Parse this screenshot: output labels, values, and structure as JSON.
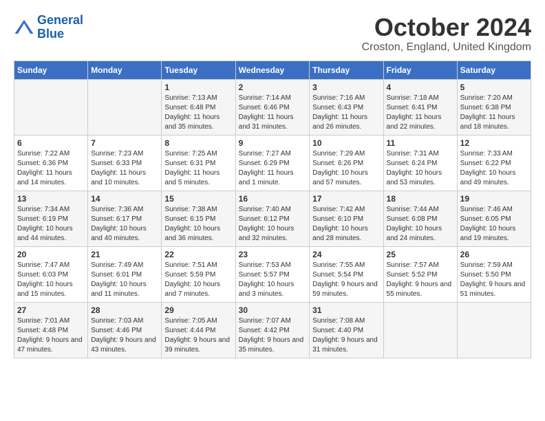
{
  "logo": {
    "line1": "General",
    "line2": "Blue"
  },
  "header": {
    "month": "October 2024",
    "location": "Croston, England, United Kingdom"
  },
  "weekdays": [
    "Sunday",
    "Monday",
    "Tuesday",
    "Wednesday",
    "Thursday",
    "Friday",
    "Saturday"
  ],
  "weeks": [
    [
      {
        "day": "",
        "sunrise": "",
        "sunset": "",
        "daylight": ""
      },
      {
        "day": "",
        "sunrise": "",
        "sunset": "",
        "daylight": ""
      },
      {
        "day": "1",
        "sunrise": "Sunrise: 7:13 AM",
        "sunset": "Sunset: 6:48 PM",
        "daylight": "Daylight: 11 hours and 35 minutes."
      },
      {
        "day": "2",
        "sunrise": "Sunrise: 7:14 AM",
        "sunset": "Sunset: 6:46 PM",
        "daylight": "Daylight: 11 hours and 31 minutes."
      },
      {
        "day": "3",
        "sunrise": "Sunrise: 7:16 AM",
        "sunset": "Sunset: 6:43 PM",
        "daylight": "Daylight: 11 hours and 26 minutes."
      },
      {
        "day": "4",
        "sunrise": "Sunrise: 7:18 AM",
        "sunset": "Sunset: 6:41 PM",
        "daylight": "Daylight: 11 hours and 22 minutes."
      },
      {
        "day": "5",
        "sunrise": "Sunrise: 7:20 AM",
        "sunset": "Sunset: 6:38 PM",
        "daylight": "Daylight: 11 hours and 18 minutes."
      }
    ],
    [
      {
        "day": "6",
        "sunrise": "Sunrise: 7:22 AM",
        "sunset": "Sunset: 6:36 PM",
        "daylight": "Daylight: 11 hours and 14 minutes."
      },
      {
        "day": "7",
        "sunrise": "Sunrise: 7:23 AM",
        "sunset": "Sunset: 6:33 PM",
        "daylight": "Daylight: 11 hours and 10 minutes."
      },
      {
        "day": "8",
        "sunrise": "Sunrise: 7:25 AM",
        "sunset": "Sunset: 6:31 PM",
        "daylight": "Daylight: 11 hours and 5 minutes."
      },
      {
        "day": "9",
        "sunrise": "Sunrise: 7:27 AM",
        "sunset": "Sunset: 6:29 PM",
        "daylight": "Daylight: 11 hours and 1 minute."
      },
      {
        "day": "10",
        "sunrise": "Sunrise: 7:29 AM",
        "sunset": "Sunset: 6:26 PM",
        "daylight": "Daylight: 10 hours and 57 minutes."
      },
      {
        "day": "11",
        "sunrise": "Sunrise: 7:31 AM",
        "sunset": "Sunset: 6:24 PM",
        "daylight": "Daylight: 10 hours and 53 minutes."
      },
      {
        "day": "12",
        "sunrise": "Sunrise: 7:33 AM",
        "sunset": "Sunset: 6:22 PM",
        "daylight": "Daylight: 10 hours and 49 minutes."
      }
    ],
    [
      {
        "day": "13",
        "sunrise": "Sunrise: 7:34 AM",
        "sunset": "Sunset: 6:19 PM",
        "daylight": "Daylight: 10 hours and 44 minutes."
      },
      {
        "day": "14",
        "sunrise": "Sunrise: 7:36 AM",
        "sunset": "Sunset: 6:17 PM",
        "daylight": "Daylight: 10 hours and 40 minutes."
      },
      {
        "day": "15",
        "sunrise": "Sunrise: 7:38 AM",
        "sunset": "Sunset: 6:15 PM",
        "daylight": "Daylight: 10 hours and 36 minutes."
      },
      {
        "day": "16",
        "sunrise": "Sunrise: 7:40 AM",
        "sunset": "Sunset: 6:12 PM",
        "daylight": "Daylight: 10 hours and 32 minutes."
      },
      {
        "day": "17",
        "sunrise": "Sunrise: 7:42 AM",
        "sunset": "Sunset: 6:10 PM",
        "daylight": "Daylight: 10 hours and 28 minutes."
      },
      {
        "day": "18",
        "sunrise": "Sunrise: 7:44 AM",
        "sunset": "Sunset: 6:08 PM",
        "daylight": "Daylight: 10 hours and 24 minutes."
      },
      {
        "day": "19",
        "sunrise": "Sunrise: 7:46 AM",
        "sunset": "Sunset: 6:05 PM",
        "daylight": "Daylight: 10 hours and 19 minutes."
      }
    ],
    [
      {
        "day": "20",
        "sunrise": "Sunrise: 7:47 AM",
        "sunset": "Sunset: 6:03 PM",
        "daylight": "Daylight: 10 hours and 15 minutes."
      },
      {
        "day": "21",
        "sunrise": "Sunrise: 7:49 AM",
        "sunset": "Sunset: 6:01 PM",
        "daylight": "Daylight: 10 hours and 11 minutes."
      },
      {
        "day": "22",
        "sunrise": "Sunrise: 7:51 AM",
        "sunset": "Sunset: 5:59 PM",
        "daylight": "Daylight: 10 hours and 7 minutes."
      },
      {
        "day": "23",
        "sunrise": "Sunrise: 7:53 AM",
        "sunset": "Sunset: 5:57 PM",
        "daylight": "Daylight: 10 hours and 3 minutes."
      },
      {
        "day": "24",
        "sunrise": "Sunrise: 7:55 AM",
        "sunset": "Sunset: 5:54 PM",
        "daylight": "Daylight: 9 hours and 59 minutes."
      },
      {
        "day": "25",
        "sunrise": "Sunrise: 7:57 AM",
        "sunset": "Sunset: 5:52 PM",
        "daylight": "Daylight: 9 hours and 55 minutes."
      },
      {
        "day": "26",
        "sunrise": "Sunrise: 7:59 AM",
        "sunset": "Sunset: 5:50 PM",
        "daylight": "Daylight: 9 hours and 51 minutes."
      }
    ],
    [
      {
        "day": "27",
        "sunrise": "Sunrise: 7:01 AM",
        "sunset": "Sunset: 4:48 PM",
        "daylight": "Daylight: 9 hours and 47 minutes."
      },
      {
        "day": "28",
        "sunrise": "Sunrise: 7:03 AM",
        "sunset": "Sunset: 4:46 PM",
        "daylight": "Daylight: 9 hours and 43 minutes."
      },
      {
        "day": "29",
        "sunrise": "Sunrise: 7:05 AM",
        "sunset": "Sunset: 4:44 PM",
        "daylight": "Daylight: 9 hours and 39 minutes."
      },
      {
        "day": "30",
        "sunrise": "Sunrise: 7:07 AM",
        "sunset": "Sunset: 4:42 PM",
        "daylight": "Daylight: 9 hours and 35 minutes."
      },
      {
        "day": "31",
        "sunrise": "Sunrise: 7:08 AM",
        "sunset": "Sunset: 4:40 PM",
        "daylight": "Daylight: 9 hours and 31 minutes."
      },
      {
        "day": "",
        "sunrise": "",
        "sunset": "",
        "daylight": ""
      },
      {
        "day": "",
        "sunrise": "",
        "sunset": "",
        "daylight": ""
      }
    ]
  ]
}
